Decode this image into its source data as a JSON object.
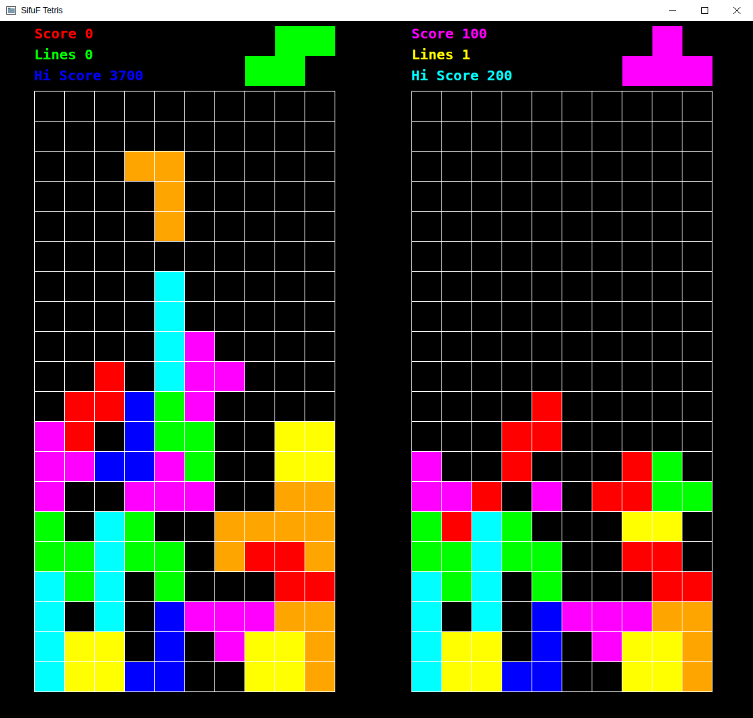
{
  "window": {
    "title": "SifuF Tetris"
  },
  "palette": {
    "R": "#ff0000",
    "G": "#00ff00",
    "B": "#0000ff",
    "C": "#00ffff",
    "M": "#ff00ff",
    "Y": "#ffff00",
    "O": "#ffa500"
  },
  "players": [
    {
      "stats": [
        {
          "label": "Score 0",
          "color": "#ff0000"
        },
        {
          "label": "Lines 0",
          "color": "#00ff00"
        },
        {
          "label": "Hi Score 3700",
          "color": "#0000ff"
        }
      ],
      "next": [
        ".GG",
        "GG."
      ],
      "board": [
        "..........",
        "..........",
        "...OO.....",
        "....O.....",
        "....O.....",
        "..........",
        "....C.....",
        "....C.....",
        "....CM....",
        "..R.CMM...",
        ".RRBGM....",
        "MR.BGG..YY",
        "MMBBMG..YY",
        "M..MMM..OO",
        "G.CG..OOOO",
        "GGCGG.ORRO",
        "CGC.G...RR",
        "C.C.BMMMOO",
        "CYY.B.MYYO",
        "CYYBB..YYO"
      ]
    },
    {
      "stats": [
        {
          "label": "Score 100",
          "color": "#ff00ff"
        },
        {
          "label": "Lines 1",
          "color": "#ffff00"
        },
        {
          "label": "Hi Score 200",
          "color": "#00ffff"
        }
      ],
      "next": [
        ".M.",
        "MMM"
      ],
      "board": [
        "..........",
        "..........",
        "..........",
        "..........",
        "..........",
        "..........",
        "..........",
        "..........",
        "..........",
        "..........",
        "....R.....",
        "...RR.....",
        "M..R...RG.",
        "MMR.M.RRGG",
        "GRCG...YY.",
        "GGCGG..RR.",
        "CGC.G...RR",
        "C.C.BMMMOO",
        "CYY.B.MYYO",
        "CYYBB..YYO"
      ]
    }
  ]
}
